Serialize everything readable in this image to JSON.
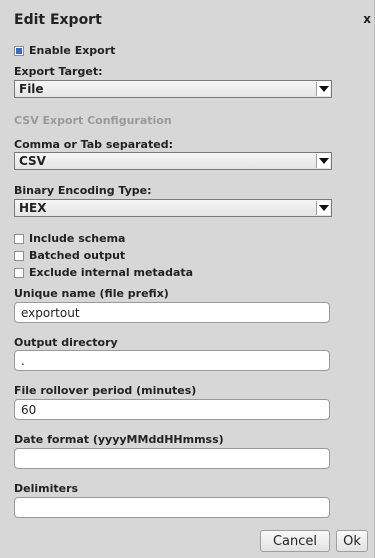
{
  "dialog": {
    "title": "Edit Export",
    "close_label": "x"
  },
  "enable_export": {
    "label": "Enable Export",
    "checked": true
  },
  "export_target": {
    "label": "Export Target:",
    "value": "File"
  },
  "csv_section": {
    "title": "CSV Export Configuration"
  },
  "separator": {
    "label": "Comma or Tab separated:",
    "value": "CSV"
  },
  "binary_encoding": {
    "label": "Binary Encoding Type:",
    "value": "HEX"
  },
  "options": {
    "include_schema": {
      "label": "Include schema",
      "checked": false
    },
    "batched_output": {
      "label": "Batched output",
      "checked": false
    },
    "exclude_metadata": {
      "label": "Exclude internal metadata",
      "checked": false
    }
  },
  "fields": {
    "unique_name": {
      "label": "Unique name (file prefix)",
      "value": "exportout"
    },
    "output_directory": {
      "label": "Output directory",
      "value": "."
    },
    "rollover_period": {
      "label": "File rollover period (minutes)",
      "value": "60"
    },
    "date_format": {
      "label": "Date format (yyyyMMddHHmmss)",
      "value": ""
    },
    "delimiters": {
      "label": "Delimiters",
      "value": ""
    }
  },
  "buttons": {
    "cancel": "Cancel",
    "ok": "Ok"
  }
}
